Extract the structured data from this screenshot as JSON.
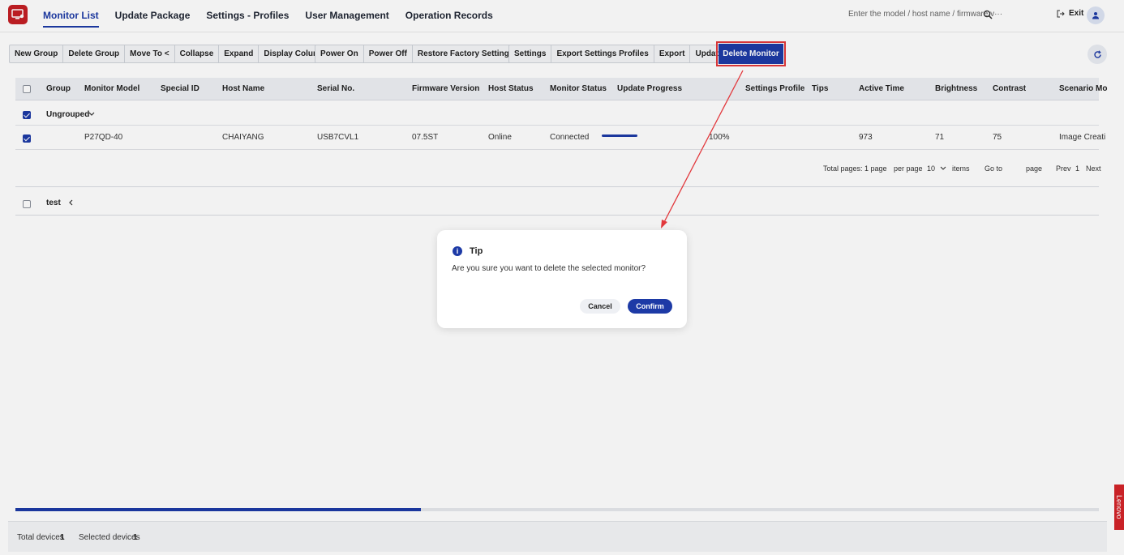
{
  "nav": {
    "tabs": [
      "Monitor List",
      "Update Package",
      "Settings - Profiles",
      "User Management",
      "Operation Records"
    ],
    "search_placeholder": "Enter the model / host name / firmware v···",
    "exit_label": "Exit"
  },
  "toolbar": {
    "group1": [
      "New Group",
      "Delete Group",
      "Move To <",
      "Collapse",
      "Expand",
      "Display Columns"
    ],
    "group2": [
      "Power On",
      "Power Off",
      "Restore Factory Settings"
    ],
    "group3": [
      "Settings",
      "Export Settings Profiles",
      "Export",
      "Update"
    ],
    "delete_label": "Delete Monitor"
  },
  "table": {
    "columns": [
      "Group",
      "Monitor Model",
      "Special ID",
      "Host Name",
      "Serial No.",
      "Firmware Version",
      "Host Status",
      "Monitor Status",
      "Update Progress",
      "Settings Profile",
      "Tips",
      "Active Time",
      "Brightness",
      "Contrast",
      "Scenario Mo"
    ],
    "group_ungrouped": "Ungrouped",
    "row": {
      "model": "P27QD-40",
      "host": "CHAIYANG",
      "serial": "USB7CVL1",
      "firmware": "07.5ST",
      "host_status": "Online",
      "monitor_status": "Connected",
      "progress": "100%",
      "progress_fraction": 1.0,
      "active_time": "973",
      "brightness": "71",
      "contrast": "75",
      "scenario": "Image Creati"
    },
    "pager": {
      "total": "Total pages: 1 page",
      "per_page": "per page",
      "per_page_value": "10",
      "items": "items",
      "goto": "Go to",
      "page": "page",
      "prev": "Prev",
      "current": "1",
      "next": "Next"
    },
    "group_test": "test"
  },
  "footer": {
    "total_label": "Total devices",
    "total_value": "1",
    "selected_label": "Selected devices",
    "selected_value": "1"
  },
  "side_tab": "Lenovo",
  "modal": {
    "title": "Tip",
    "message": "Are you sure you want to delete the selected monitor?",
    "cancel": "Cancel",
    "confirm": "Confirm"
  },
  "colors": {
    "brand": "#c51f24",
    "accent": "#1d3aa6",
    "highlight": "#e2383c"
  }
}
